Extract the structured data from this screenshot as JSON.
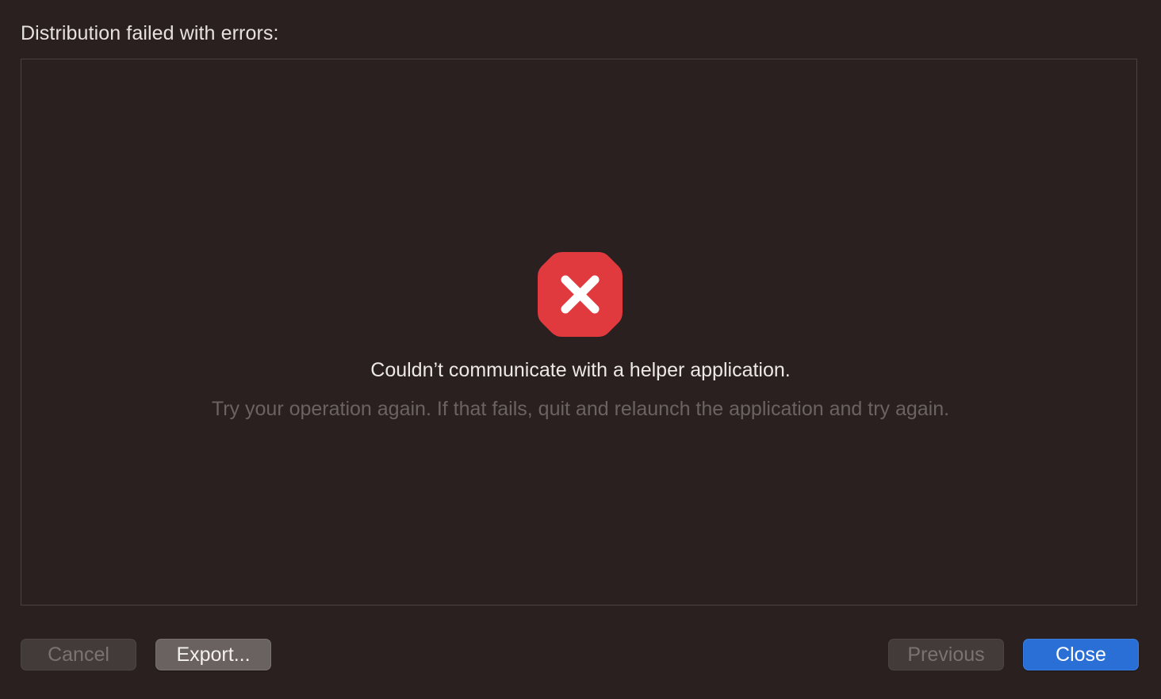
{
  "header": {
    "title": "Distribution failed with errors:"
  },
  "error": {
    "icon": "error-octagon-x-icon",
    "icon_color": "#e0393e",
    "message": "Couldn’t communicate with a helper application.",
    "detail": "Try your operation again. If that fails, quit and relaunch the application and try again."
  },
  "footer": {
    "cancel_label": "Cancel",
    "export_label": "Export...",
    "previous_label": "Previous",
    "close_label": "Close"
  },
  "colors": {
    "background": "#2a201f",
    "accent": "#2a6fd6"
  }
}
